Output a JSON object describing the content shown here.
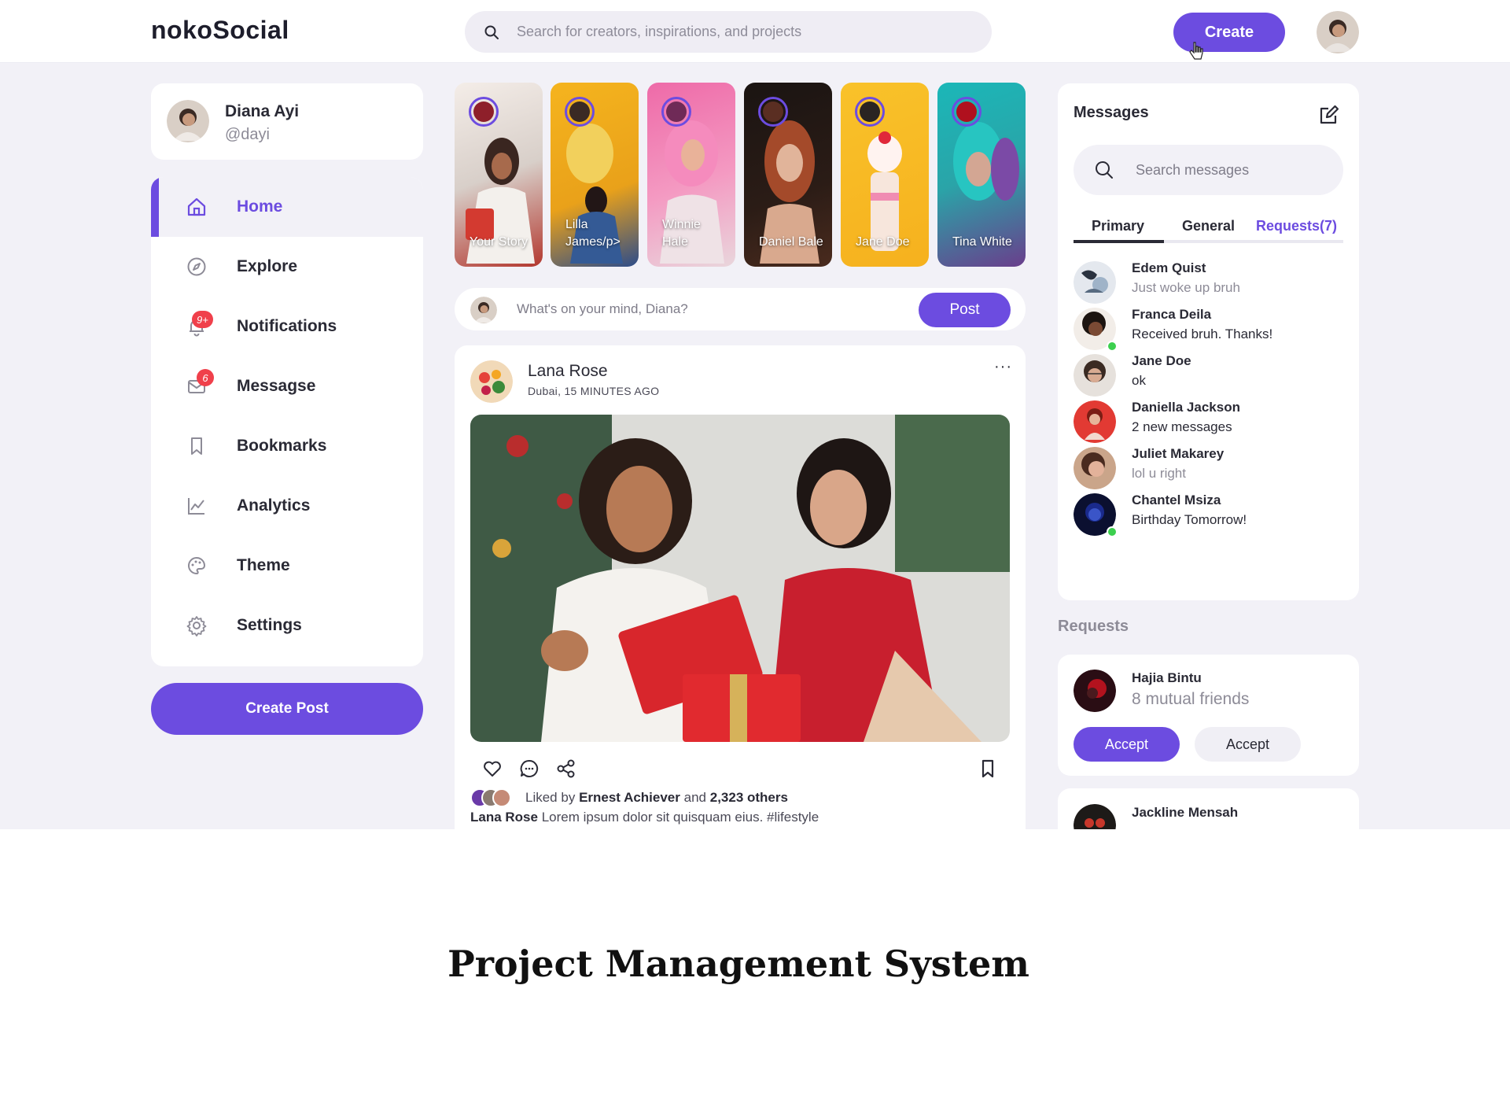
{
  "header": {
    "brand": "nokoSocial",
    "search_placeholder": "Search for creators, inspirations, and projects",
    "create_label": "Create"
  },
  "profile": {
    "name": "Diana Ayi",
    "handle": "@dayi"
  },
  "sidebar": {
    "items": [
      {
        "label": "Home",
        "icon": "home-icon",
        "active": true
      },
      {
        "label": "Explore",
        "icon": "compass-icon"
      },
      {
        "label": "Notifications",
        "icon": "bell-icon",
        "badge": "9+"
      },
      {
        "label": "Messagse",
        "icon": "mail-icon",
        "badge": "6"
      },
      {
        "label": "Bookmarks",
        "icon": "bookmark-icon"
      },
      {
        "label": "Analytics",
        "icon": "chart-icon"
      },
      {
        "label": "Theme",
        "icon": "palette-icon"
      },
      {
        "label": "Settings",
        "icon": "gear-icon"
      }
    ],
    "create_post_label": "Create Post"
  },
  "stories": [
    {
      "name": "Your Story"
    },
    {
      "name": "Lilla James/p>"
    },
    {
      "name": "Winnie Hale"
    },
    {
      "name": "Daniel Bale"
    },
    {
      "name": "Jane Doe"
    },
    {
      "name": "Tina White"
    }
  ],
  "composer": {
    "placeholder": "What's on your mind, Diana?",
    "post_label": "Post"
  },
  "feed": {
    "author": "Lana Rose",
    "meta": "Dubai, 15 MINUTES AGO",
    "more": "···",
    "liked_prefix": "Liked by",
    "liked_name": "Ernest Achiever",
    "liked_and": "and",
    "liked_count": "2,323 others",
    "caption_author": "Lana Rose",
    "caption_text": "Lorem ipsum dolor sit quisquam eius. #lifestyle"
  },
  "messages": {
    "title": "Messages",
    "search_placeholder": "Search messages",
    "tabs": [
      "Primary",
      "General",
      "Requests(7)"
    ],
    "chats": [
      {
        "name": "Edem Quist",
        "message": "Just woke up bruh",
        "online": false,
        "muted": true
      },
      {
        "name": "Franca Deila",
        "message": "Received bruh. Thanks!",
        "online": true,
        "muted": false
      },
      {
        "name": "Jane Doe",
        "message": "ok",
        "online": false,
        "muted": false
      },
      {
        "name": "Daniella Jackson",
        "message": "2 new messages",
        "online": false,
        "muted": false
      },
      {
        "name": "Juliet Makarey",
        "message": "lol u right",
        "online": false,
        "muted": true
      },
      {
        "name": "Chantel Msiza",
        "message": "Birthday Tomorrow!",
        "online": true,
        "muted": false
      }
    ]
  },
  "requests": {
    "title": "Requests",
    "items": [
      {
        "name": "Hajia Bintu",
        "mutual": "8 mutual friends",
        "accept_label": "Accept",
        "decline_label": "Accept"
      },
      {
        "name": "Jackline Mensah"
      }
    ]
  },
  "caption": "Project Management System",
  "colors": {
    "accent": "#6c4ce0",
    "background": "#f2f1f7",
    "badge": "#f0404b",
    "online": "#3ccf4e"
  }
}
